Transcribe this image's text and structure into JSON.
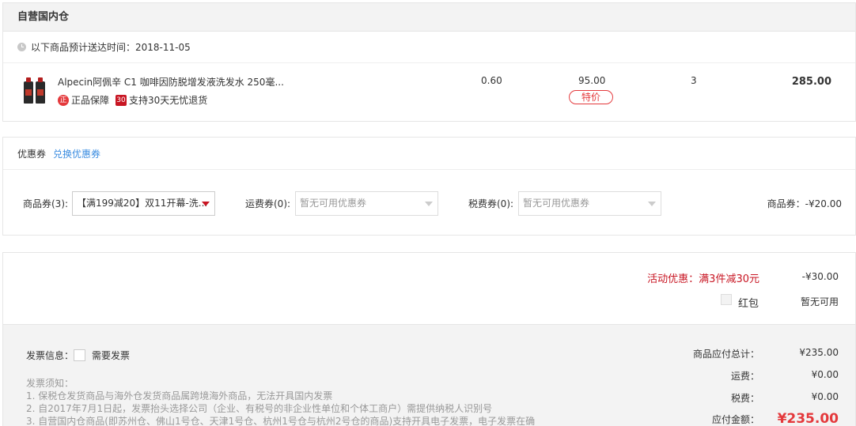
{
  "warehouse": {
    "title": "自营国内仓",
    "delivery_text": "以下商品预计送达时间：2018-11-05",
    "product": {
      "name": "Alpecin阿佩辛 C1 咖啡因防脱增发液洗发水 250毫...",
      "tag1": "正品保障",
      "tag1_icon": "正",
      "tag2": "支持30天无忧退货",
      "tag2_icon": "30",
      "discount": "0.60",
      "price": "95.00",
      "special_badge": "特价",
      "quantity": "3",
      "subtotal": "285.00"
    }
  },
  "coupon": {
    "title": "优惠券",
    "redeem_link": "兑换优惠券",
    "goods_label": "商品券(3):",
    "goods_selected": "【满199减20】双11开幕-洗...",
    "shipping_label": "运费券(0):",
    "shipping_placeholder": "暂无可用优惠券",
    "tax_label": "税费券(0):",
    "tax_placeholder": "暂无可用优惠券",
    "goods_discount": "商品券：-¥20.00"
  },
  "summary": {
    "promo_label": "活动优惠：满3件减30元",
    "promo_value": "-¥30.00",
    "red_packet_label": "红包",
    "red_packet_value": "暂无可用",
    "invoice_label": "发票信息：",
    "invoice_need": "需要发票",
    "notes": [
      "发票须知：",
      "1. 保税仓发货商品与海外仓发货商品属跨境海外商品，无法开具国内发票",
      "2. 自2017年7月1日起，发票抬头选择公司（企业、有税号的非企业性单位和个体工商户）需提供纳税人识别号",
      "3. 自营国内仓商品(即苏州仓、佛山1号仓、天津1号仓、杭州1号仓与杭州2号仓的商品)支持开具电子发票，电子发票在确"
    ],
    "goods_total_label": "商品应付总计：",
    "goods_total": "¥235.00",
    "shipping_label": "运费：",
    "shipping": "¥0.00",
    "tax_label": "税费：",
    "tax": "¥0.00",
    "due_label": "应付金额：",
    "due": "¥235.00"
  },
  "colors": {
    "accent_red": "#e4393c",
    "link_blue": "#3a8ce0"
  }
}
